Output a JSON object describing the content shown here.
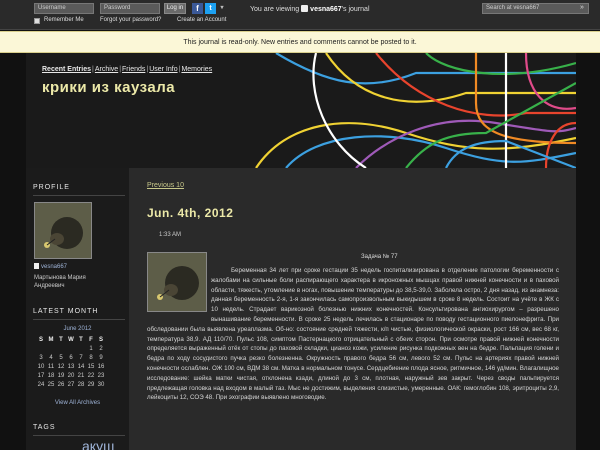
{
  "topbar": {
    "username_placeholder": "Username",
    "password_placeholder": "Password",
    "login_label": "Log in",
    "remember_label": "Remember Me",
    "forgot_label": "Forgot your password?",
    "create_label": "Create an Account",
    "viewing_prefix": "You are viewing",
    "viewing_user": "vesna667",
    "viewing_suffix": "'s journal",
    "search_placeholder": "Search at vesna667",
    "search_go": "»",
    "icons": [
      "facebook-icon",
      "twitter-icon",
      "more-icon"
    ]
  },
  "notice": "This journal is read-only. New entries and comments cannot be posted to it.",
  "nav": {
    "items": [
      "Recent Entries",
      "Archive",
      "Friends",
      "User Info",
      "Memories"
    ]
  },
  "journal_title": "крики из каузала",
  "sidebar": {
    "profile_heading": "PROFILE",
    "username": "vesna667",
    "realname": "Мартынова Мария Андреевич",
    "latest_heading": "LATEST MONTH",
    "calendar_month": "June 2012",
    "dow": [
      "S",
      "M",
      "T",
      "W",
      "T",
      "F",
      "S"
    ],
    "weeks": [
      [
        "",
        "",
        "",
        "",
        "",
        "1",
        "2"
      ],
      [
        "3",
        "4",
        "5",
        "6",
        "7",
        "8",
        "9"
      ],
      [
        "10",
        "11",
        "12",
        "13",
        "14",
        "15",
        "16"
      ],
      [
        "17",
        "18",
        "19",
        "20",
        "21",
        "22",
        "23"
      ],
      [
        "24",
        "25",
        "26",
        "27",
        "28",
        "29",
        "30"
      ]
    ],
    "view_all": "View All Archives",
    "tags_heading": "TAGS",
    "tag": "акуш"
  },
  "main": {
    "prev_label": "Previous 10",
    "date": "Jun. 4th, 2012",
    "time": "1:33 AM",
    "task_title": "Задача № 77",
    "body": "Беременная 34 лет при сроке гестации 35 недель госпитализирована в отделение патологии беременности с жалобами на сильные боли распирающего характера в икроножных мышцах правой нижней конечности и в паховой области, тяжесть, утомление в ногах, повышение температуры до 38,5-39,0. Заболела остро, 2 дня назад, из анамнеза: данная беременность 2-я, 1-я закончилась самопроизвольным выкидышем в сроке 8 недель. Состоит на учёте в ЖК с 10 недель. Страдает варикозной болезнью нижних конечностей. Консультирована ангиохирургом – разрешено вынашивание беременности. В сроке 25 недель лечилась в стационаре по поводу гестационного пиелонефрита. При обследовании была выявлена уреаплазма. Об-но: состояние средней тяжести, к/п чистые, физиологической окраски, рост 166 см, вес 68 кг, температура 38,9. АД 110/70. Пульс 108, симптом Пастернацкого отрицательный с обеих сторон. При осмотре правой нижней конечности определяется выраженный отёк от стопы до паховой складки, цианоз кожи, усиление рисунка подкожных вен на бедре. Пальпация голени и бедра по ходу сосудистого пучка резко болезненна. Окружность правого бедра 56 см, левого 52 см. Пульс на артериях правой нижней конечности ослаблен. ОЖ 100 см, ВДМ 38 см. Матка в нормальном тонусе. Сердцебиение плода ясное, ритмичное, 146 уд/мин. Влагалищное исследование: шейка матки чистая, отклонена кзади, длиной до 3 см, плотная, наружный зев закрыт. Через своды пальпируется предлежащая головка над входом в малый таз. Мыс не достижим, выделения слизистые, умеренные. ОАК: гемоглобин 108, эритроциты 2,9, лейкоциты 12, СОЭ 48. При эхографии выявлено многоводие."
  },
  "colors": {
    "accent_title": "#ece9a8",
    "link_blue": "#9fb4d8",
    "notice_bg": "#fbf7d7",
    "header_lines": [
      "#f0d233",
      "#e8442d",
      "#3ca0e0",
      "#38b14a",
      "#9f5ab8",
      "#f08a24",
      "#ffffff",
      "#e04b8a"
    ]
  }
}
